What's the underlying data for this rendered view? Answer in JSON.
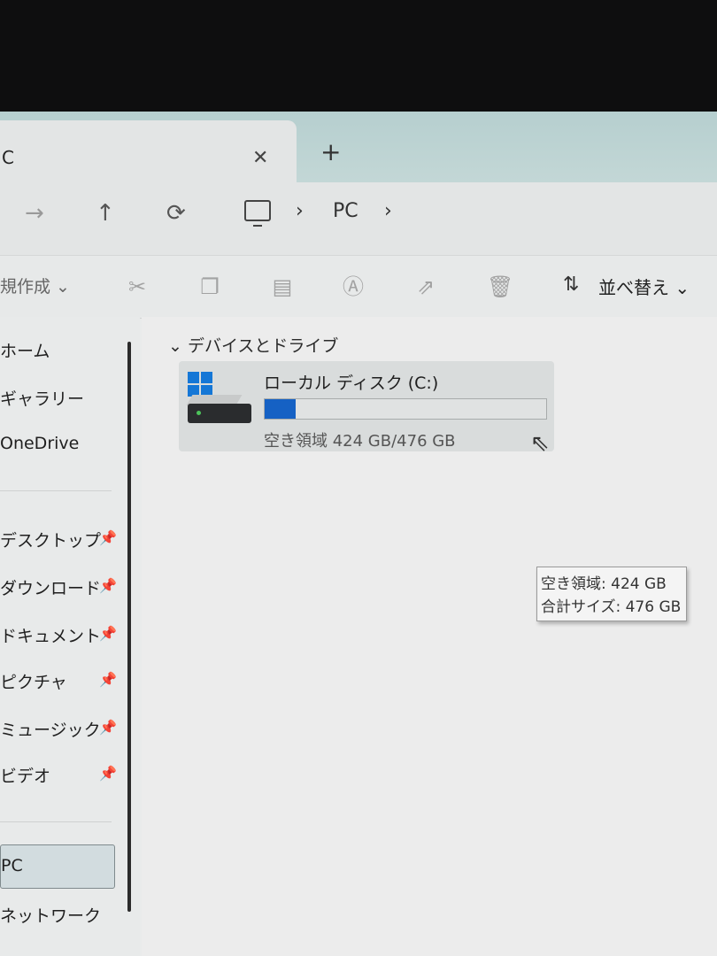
{
  "tab": {
    "title": "C",
    "close_icon": "close-icon",
    "new_tab_icon": "plus-icon"
  },
  "nav": {
    "forward_icon": "arrow-right-icon",
    "up_icon": "arrow-up-icon",
    "refresh_icon": "refresh-icon",
    "breadcrumb": [
      "PC"
    ],
    "chevron": "›"
  },
  "command_bar": {
    "new_label": "規作成",
    "sort_label": "並べ替え",
    "icons": [
      "cut-icon",
      "copy-icon",
      "paste-icon",
      "rename-icon",
      "share-icon",
      "delete-icon"
    ]
  },
  "sidebar": {
    "items": [
      {
        "label": "ホーム"
      },
      {
        "label": "ギャラリー"
      },
      {
        "label": "OneDrive"
      }
    ],
    "pinned": [
      {
        "label": "デスクトップ"
      },
      {
        "label": "ダウンロード"
      },
      {
        "label": "ドキュメント"
      },
      {
        "label": "ピクチャ"
      },
      {
        "label": "ミュージック"
      },
      {
        "label": "ビデオ"
      }
    ],
    "pc_label": "PC",
    "network_label": "ネットワーク"
  },
  "content": {
    "group_header": "デバイスとドライブ",
    "drive": {
      "name": "ローカル ディスク (C:)",
      "free_text": "空き領域 424 GB/476 GB",
      "used_fraction": 0.11
    },
    "tooltip": {
      "free_line": "空き領域: 424 GB",
      "total_line": "合計サイズ: 476 GB"
    }
  },
  "colors": {
    "accent": "#1561c4",
    "windows_logo": "#1577d6"
  }
}
